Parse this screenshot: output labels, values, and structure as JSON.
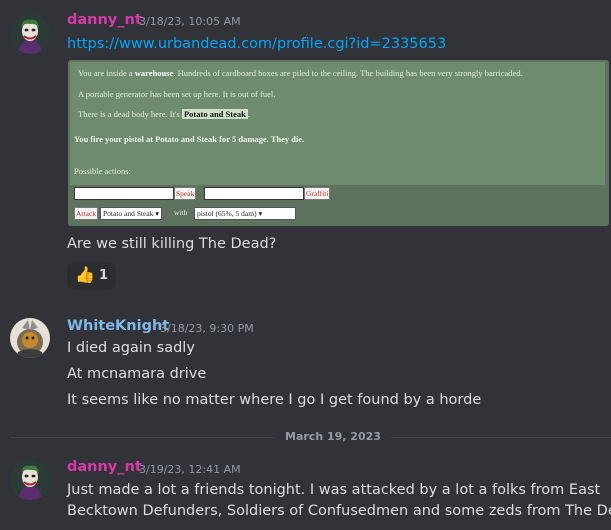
{
  "messages": [
    {
      "author": "danny_nt",
      "author_color": "#d83aaa",
      "timestamp": "3/18/23, 10:05 AM",
      "link": "https://www.urbandead.com/profile.cgi?id=2335653",
      "embed": {
        "inside_pre": "You are inside a ",
        "inside_bold": "warehouse",
        "inside_post": ". Hundreds of cardboard boxes are piled to the ceiling. The building has been very strongly barricaded.",
        "generator": "A portable generator has been set up here. It is out of fuel.",
        "body_pre": "There is a dead body here. It's ",
        "body_name": "Potato and Steak",
        "body_post": ".",
        "fire": "You fire your pistol at Potato and Steak for 5 damage. They die.",
        "possible_actions": "Possible actions:",
        "speak_button": "Speak",
        "graffiti_button": "Graffiti",
        "attack_button": "Attack",
        "target_select": "Potato and Steak",
        "with_label": "with",
        "weapon_select": "pistol (65%, 5 dam)"
      },
      "text": "Are we still killing The Dead?",
      "reaction": {
        "emoji": "👍",
        "count": "1"
      }
    },
    {
      "author": "WhiteKnight",
      "author_color": "#7eb9e8",
      "timestamp": "3/18/23, 9:30 PM",
      "lines": [
        "I died again sadly",
        "At mcnamara drive",
        "It seems like no matter where I go I get found by a horde"
      ]
    },
    {
      "author": "danny_nt",
      "author_color": "#d83aaa",
      "timestamp": "3/19/23, 12:41 AM",
      "lines": [
        "Just made a lot a friends tonight. I was attacked by a lot a folks from East",
        "Becktown Defunders, Soldiers of Confusedmen and some zeds from The Dead."
      ]
    }
  ],
  "date_divider": "March 19, 2023"
}
